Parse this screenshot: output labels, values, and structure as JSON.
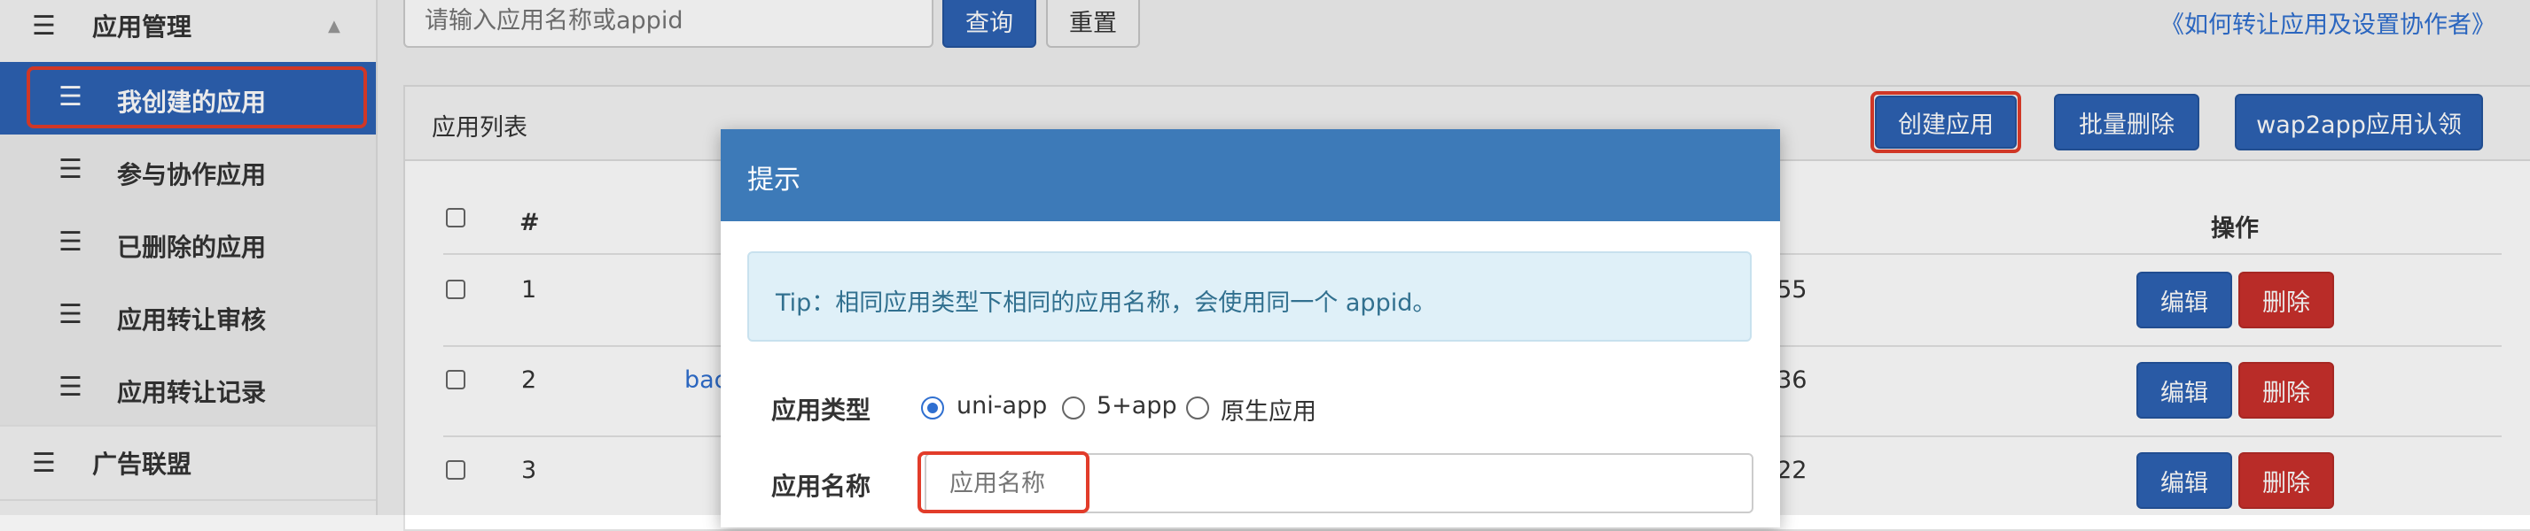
{
  "sidebar": {
    "group_app_mgmt": "应用管理",
    "items": [
      {
        "label": "我创建的应用"
      },
      {
        "label": "参与协作应用"
      },
      {
        "label": "已删除的应用"
      },
      {
        "label": "应用转让审核"
      },
      {
        "label": "应用转让记录"
      }
    ],
    "group_ad": "广告联盟"
  },
  "search": {
    "placeholder": "请输入应用名称或appid",
    "query_label": "查询",
    "reset_label": "重置"
  },
  "help_link": "《如何转让应用及设置协作者》",
  "panel": {
    "title": "应用列表",
    "create_label": "创建应用",
    "batch_delete_label": "批量删除",
    "wap2app_label": "wap2app应用认领"
  },
  "table": {
    "headers": {
      "index": "#",
      "actions": "操作"
    },
    "rows": [
      {
        "index": "1",
        "name": "",
        "time_tail": ":55",
        "edit": "编辑",
        "delete": "删除"
      },
      {
        "index": "2",
        "name": "bac",
        "time_tail": ":36",
        "edit": "编辑",
        "delete": "删除"
      },
      {
        "index": "3",
        "name": "",
        "time_tail": ":22",
        "edit": "编辑",
        "delete": "删除"
      }
    ]
  },
  "modal": {
    "title": "提示",
    "tip": "Tip：相同应用类型下相同的应用名称，会使用同一个 appid。",
    "type_label": "应用类型",
    "type_options": [
      "uni-app",
      "5+app",
      "原生应用"
    ],
    "selected_type": "uni-app",
    "name_label": "应用名称",
    "name_placeholder": "应用名称"
  },
  "colors": {
    "primary": "#2d62b3",
    "danger": "#c9302c",
    "modal_header": "#3d7ab8",
    "highlight": "#e23c2a"
  }
}
